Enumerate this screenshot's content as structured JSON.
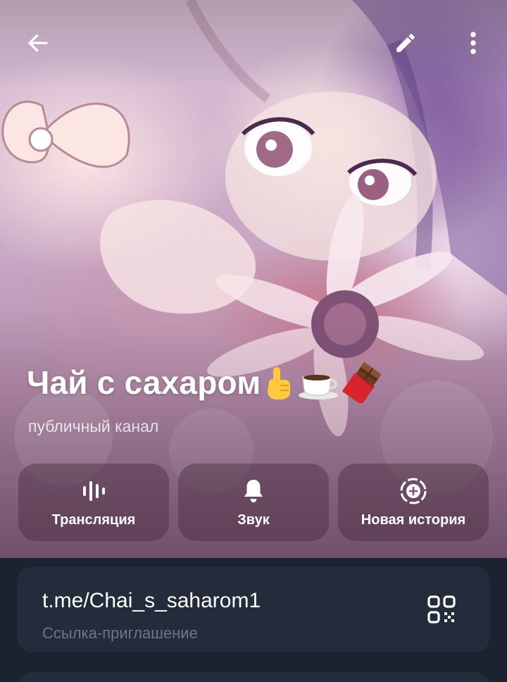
{
  "header": {
    "back_icon": "arrow-left-icon",
    "edit_icon": "pencil-icon",
    "more_icon": "more-vertical-icon"
  },
  "channel": {
    "title": "Чай с сахаром",
    "emojis": [
      "☝️",
      "☕",
      "🍫"
    ],
    "subtitle": "публичный канал"
  },
  "actions": [
    {
      "label": "Трансляция",
      "icon": "broadcast-icon"
    },
    {
      "label": "Звук",
      "icon": "bell-icon"
    },
    {
      "label": "Новая история",
      "icon": "story-add-icon"
    }
  ],
  "link": {
    "url": "t.me/Chai_s_saharom1",
    "caption": "Ссылка-приглашение",
    "icon": "qr-code-icon"
  },
  "colors": {
    "background": "#1b2230",
    "card": "#232c3b",
    "caption": "#6c7687"
  }
}
